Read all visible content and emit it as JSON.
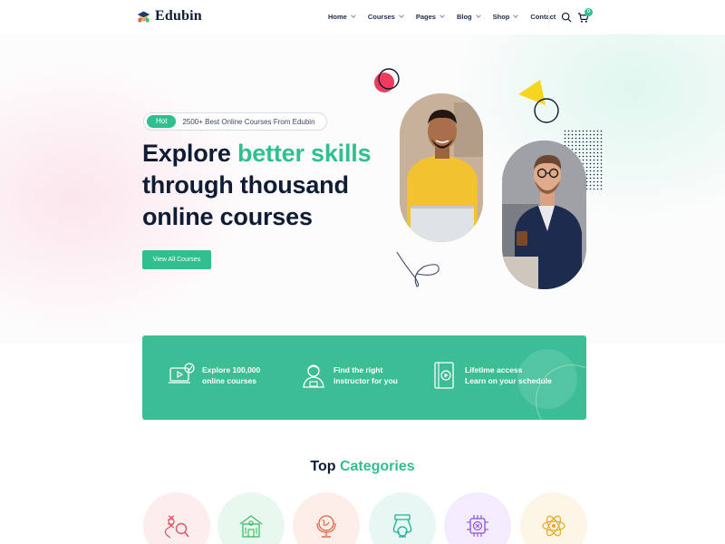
{
  "brand": {
    "name": "Edubin",
    "accent": "#30c08f"
  },
  "nav": {
    "items": [
      {
        "label": "Home",
        "has_dropdown": true
      },
      {
        "label": "Courses",
        "has_dropdown": true
      },
      {
        "label": "Pages",
        "has_dropdown": true
      },
      {
        "label": "Blog",
        "has_dropdown": true
      },
      {
        "label": "Shop",
        "has_dropdown": true
      },
      {
        "label": "Contact",
        "has_dropdown": false
      }
    ],
    "cart_count": "0",
    "icons": [
      "search-icon",
      "cart-icon"
    ]
  },
  "hero": {
    "hot_tag": "Hot",
    "hot_text": "2500+ Best Online Courses From Edubin",
    "headline_part1": "Explore ",
    "headline_accent": "better skills",
    "headline_line2": "through thousand",
    "headline_line3": "online courses",
    "cta_label": "View All Courses"
  },
  "features": {
    "background": "#3dbd96",
    "items": [
      {
        "icon": "video-course-icon",
        "line1": "Explore 100,000",
        "line2": "online courses"
      },
      {
        "icon": "instructor-icon",
        "line1": "Find the right",
        "line2": "instructor for you"
      },
      {
        "icon": "play-book-icon",
        "line1": "Lifetime access",
        "line2": "Learn on your schedule"
      }
    ]
  },
  "categories": {
    "title_part1": "Top ",
    "title_accent": "Categories",
    "items": [
      {
        "icon": "dna-search-icon",
        "bg": "#fdeeee",
        "color": "#e2566b"
      },
      {
        "icon": "school-building-icon",
        "bg": "#e9f8ee",
        "color": "#3dbd6b"
      },
      {
        "icon": "globe-icon",
        "bg": "#fdeee9",
        "color": "#e4603f"
      },
      {
        "icon": "chemistry-flask-icon",
        "bg": "#e6f7f4",
        "color": "#1fae93"
      },
      {
        "icon": "chip-icon",
        "bg": "#f3ecfd",
        "color": "#8a52d9"
      },
      {
        "icon": "atom-icon",
        "bg": "#fdf6e6",
        "color": "#e7a726"
      }
    ]
  }
}
